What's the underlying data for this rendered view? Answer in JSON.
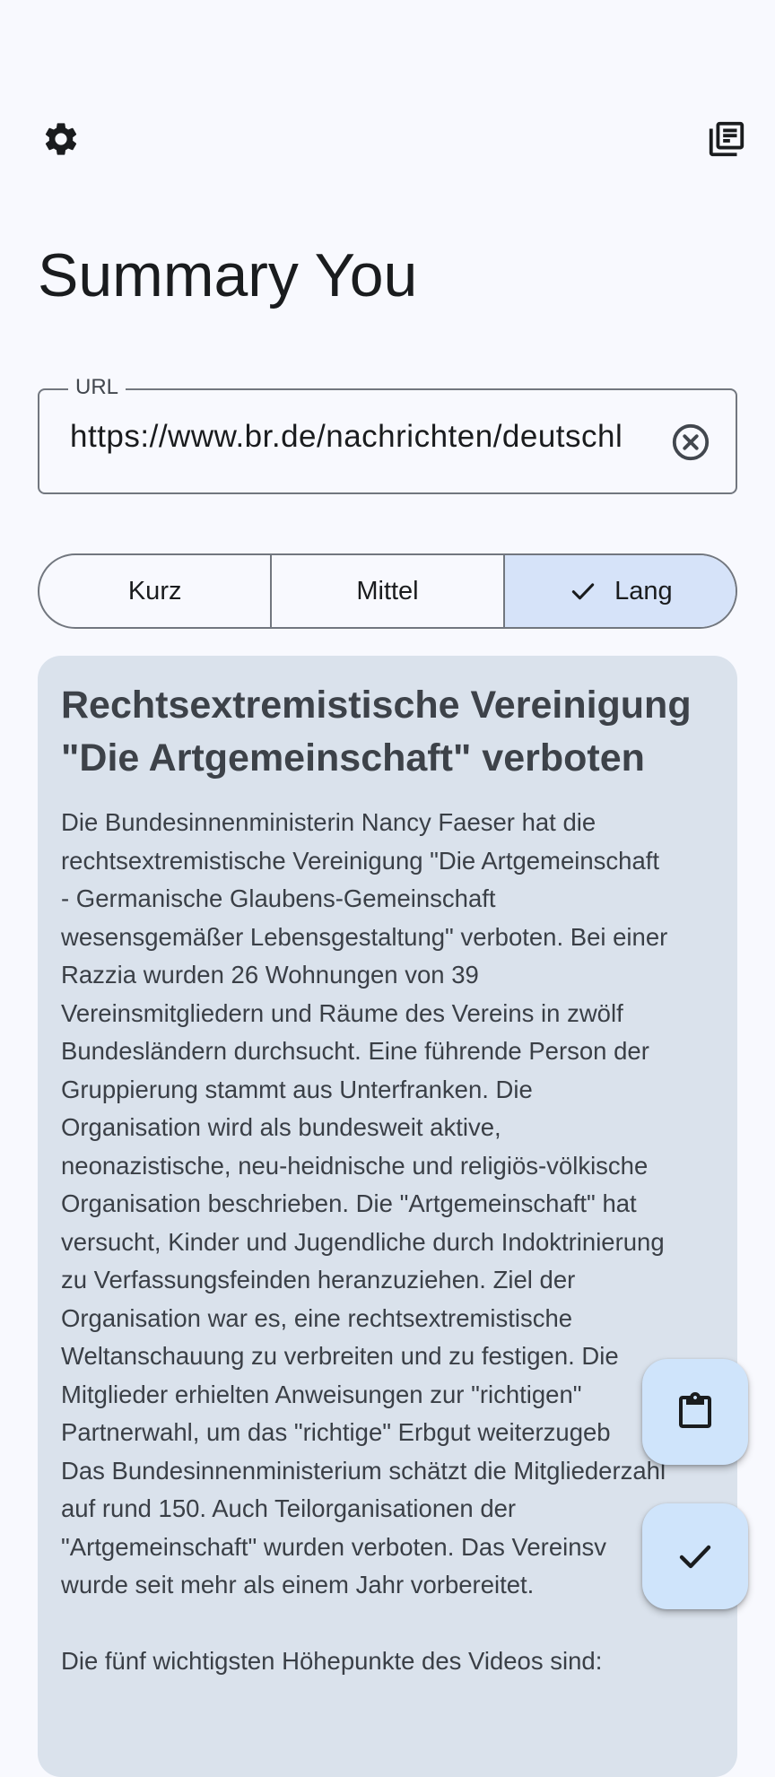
{
  "app": {
    "title": "Summary You"
  },
  "toolbar": {
    "settings_icon": "gear-icon",
    "library_icon": "library-books-icon"
  },
  "url_field": {
    "label": "URL",
    "value": "https://www.br.de/nachrichten/deutschl",
    "clear_icon": "cancel-circle-icon"
  },
  "length_selector": {
    "options": [
      {
        "label": "Kurz",
        "selected": false
      },
      {
        "label": "Mittel",
        "selected": false
      },
      {
        "label": "Lang",
        "selected": true
      }
    ]
  },
  "summary": {
    "title": "Rechtsextremistische Vereinigung \"Die Artgemeinschaft\" verboten",
    "body": "Die Bundesinnenministerin Nancy Faeser hat die\nrechtsextremistische Vereinigung \"Die Artgemeinschaft\n- Germanische Glaubens-Gemeinschaft\nwesensgemäßer Lebensgestaltung\" verboten. Bei einer\nRazzia wurden 26 Wohnungen von 39\nVereinsmitgliedern und Räume des Vereins in zwölf\nBundesländern durchsucht. Eine führende Person der\nGruppierung stammt aus Unterfranken. Die\nOrganisation wird als bundesweit aktive,\nneonazistische, neu-heidnische und religiös-völkische\nOrganisation beschrieben. Die \"Artgemeinschaft\" hat\nversucht, Kinder und Jugendliche durch Indoktrinierung\nzu Verfassungsfeinden heranzuziehen. Ziel der\nOrganisation war es, eine rechtsextremistische\nWeltanschauung zu verbreiten und zu festigen. Die\nMitglieder erhielten Anweisungen zur \"richtigen\"\nPartnerwahl, um das \"richtige\" Erbgut weiterzugeb\nDas Bundesinnenministerium schätzt die Mitgliederzahl\nauf rund 150. Auch Teilorganisationen der\n\"Artgemeinschaft\" wurden verboten. Das Vereinsv\nwurde seit mehr als einem Jahr vorbereitet.\n\nDie fünf wichtigsten Höhepunkte des Videos sind:"
  },
  "fabs": {
    "paste_icon": "clipboard-icon",
    "done_icon": "check-icon"
  },
  "colors": {
    "background": "#f8f9fe",
    "card": "#dae2ec",
    "selected_segment": "#d6e3f9",
    "fab": "#cfe4fb",
    "outline": "#72777f"
  }
}
